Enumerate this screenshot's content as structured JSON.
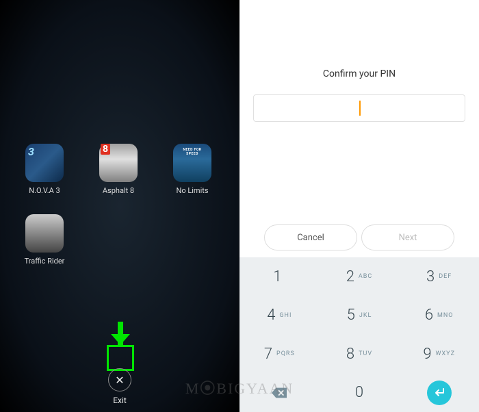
{
  "left": {
    "apps": [
      {
        "name": "N.O.V.A 3",
        "icon": "nova-icon"
      },
      {
        "name": "Asphalt 8",
        "icon": "asphalt-icon"
      },
      {
        "name": "No Limits",
        "icon": "nfs-icon"
      },
      {
        "name": "Traffic Rider",
        "icon": "traffic-icon"
      }
    ],
    "exit_label": "Exit"
  },
  "right": {
    "heading": "Confirm your PIN",
    "pin_value": "",
    "cancel_label": "Cancel",
    "next_label": "Next",
    "keypad": [
      {
        "digit": "1",
        "letters": ""
      },
      {
        "digit": "2",
        "letters": "ABC"
      },
      {
        "digit": "3",
        "letters": "DEF"
      },
      {
        "digit": "4",
        "letters": "GHI"
      },
      {
        "digit": "5",
        "letters": "JKL"
      },
      {
        "digit": "6",
        "letters": "MNO"
      },
      {
        "digit": "7",
        "letters": "PQRS"
      },
      {
        "digit": "8",
        "letters": "TUV"
      },
      {
        "digit": "9",
        "letters": "WXYZ"
      },
      {
        "digit": "",
        "letters": ""
      },
      {
        "digit": "0",
        "letters": ""
      },
      {
        "digit": "",
        "letters": ""
      }
    ]
  },
  "watermark": "MoBIGYAAN"
}
